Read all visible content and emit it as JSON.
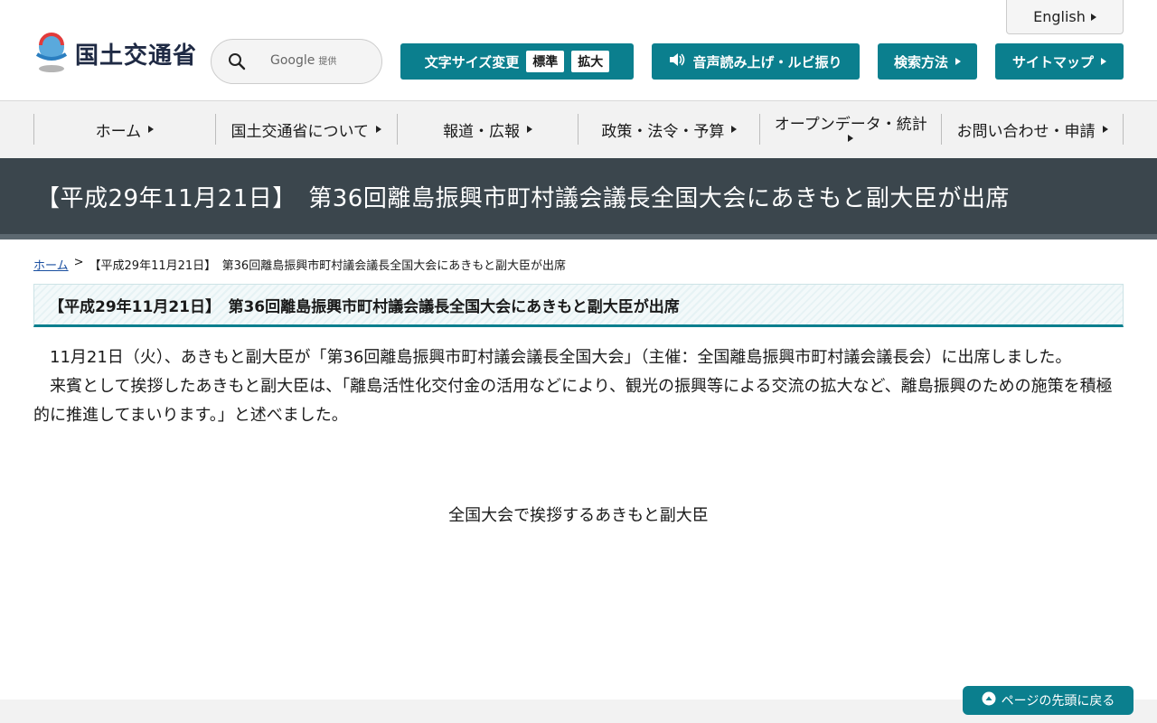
{
  "header": {
    "english_label": "English",
    "logo_text": "国土交通省",
    "search": {
      "provider_label": "Google",
      "provider_suffix": "提供",
      "placeholder": ""
    },
    "font_size": {
      "label": "文字サイズ変更",
      "standard": "標準",
      "large": "拡大"
    },
    "audio_label": "音声読み上げ・ルビ振り",
    "search_method_label": "検索方法",
    "sitemap_label": "サイトマップ"
  },
  "nav": {
    "items": [
      {
        "label": "ホーム"
      },
      {
        "label": "国土交通省について"
      },
      {
        "label": "報道・広報"
      },
      {
        "label": "政策・法令・予算"
      },
      {
        "label": "オープンデータ・統計"
      },
      {
        "label": "お問い合わせ・申請"
      }
    ]
  },
  "page": {
    "title": "【平成29年11月21日】　第36回離島振興市町村議会議長全国大会にあきもと副大臣が出席",
    "breadcrumb": {
      "home": "ホーム",
      "separator": ">",
      "current": "【平成29年11月21日】　第36回離島振興市町村議会議長全国大会にあきもと副大臣が出席"
    },
    "heading": "【平成29年11月21日】　第36回離島振興市町村議会議長全国大会にあきもと副大臣が出席",
    "paragraphs": [
      "11月21日（火）、あきもと副大臣が「第36回離島振興市町村議会議長全国大会」（主催：全国離島振興市町村議会議長会）に出席しました。",
      "来賓として挨拶したあきもと副大臣は、「離島活性化交付金の活用などにより、観光の振興等による交流の拡大など、離島振興のための施策を積極的に推進してまいります。」と述べました。"
    ],
    "caption": "全国大会で挨拶するあきもと副大臣"
  },
  "page_top_label": "ページの先頭に戻る",
  "colors": {
    "accent": "#0b7f8e",
    "banner": "#3b464d"
  }
}
